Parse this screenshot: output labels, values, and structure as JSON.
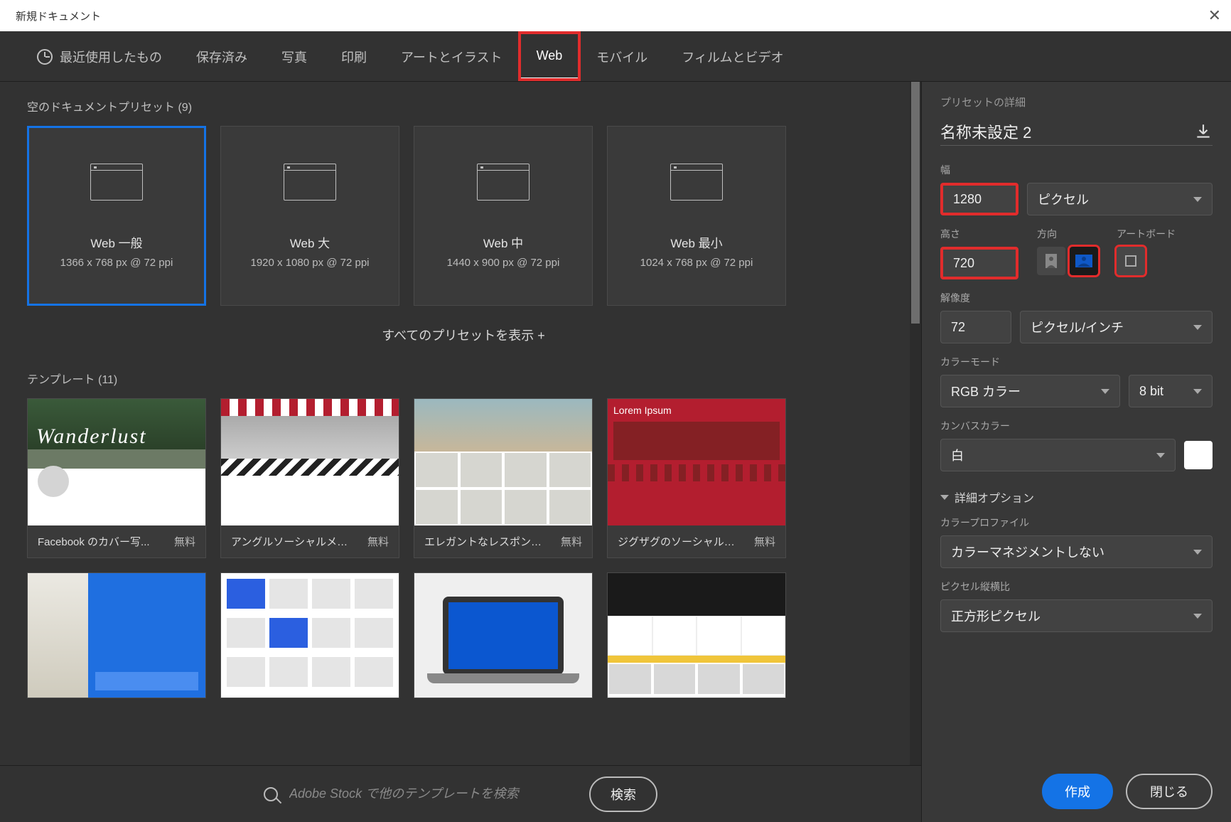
{
  "window": {
    "title": "新規ドキュメント"
  },
  "tabs": [
    {
      "label": "最近使用したもの"
    },
    {
      "label": "保存済み"
    },
    {
      "label": "写真"
    },
    {
      "label": "印刷"
    },
    {
      "label": "アートとイラスト"
    },
    {
      "label": "Web"
    },
    {
      "label": "モバイル"
    },
    {
      "label": "フィルムとビデオ"
    }
  ],
  "active_tab": "Web",
  "presets": {
    "heading_prefix": "空のドキュメントプリセット",
    "count_label": "(9)",
    "items": [
      {
        "name": "Web 一般",
        "dim": "1366 x 768 px @ 72 ppi"
      },
      {
        "name": "Web 大",
        "dim": "1920 x 1080 px @ 72 ppi"
      },
      {
        "name": "Web 中",
        "dim": "1440 x 900 px @ 72 ppi"
      },
      {
        "name": "Web 最小",
        "dim": "1024 x 768 px @ 72 ppi"
      }
    ],
    "show_all": "すべてのプリセットを表示 +"
  },
  "templates": {
    "heading_prefix": "テンプレート",
    "count_label": "(11)",
    "price_free": "無料",
    "row1": [
      {
        "name": "Facebook のカバー写..."
      },
      {
        "name": "アングルソーシャルメデ..."
      },
      {
        "name": "エレガントなレスポンシ..."
      },
      {
        "name": "ジグザグのソーシャルメ..."
      }
    ]
  },
  "search": {
    "placeholder": "Adobe Stock で他のテンプレートを検索",
    "button": "検索"
  },
  "details": {
    "header": "プリセットの詳細",
    "name_value": "名称未設定 2",
    "labels": {
      "width": "幅",
      "height": "高さ",
      "orientation": "方向",
      "artboard": "アートボード",
      "resolution": "解像度",
      "color_mode": "カラーモード",
      "canvas": "カンバスカラー",
      "advanced": "詳細オプション",
      "color_profile": "カラープロファイル",
      "pixel_ratio": "ピクセル縦横比"
    },
    "width_value": "1280",
    "height_value": "720",
    "unit_value": "ピクセル",
    "resolution_value": "72",
    "resolution_unit": "ピクセル/インチ",
    "color_mode_value": "RGB カラー",
    "bit_depth_value": "8 bit",
    "canvas_value": "白",
    "color_profile_value": "カラーマネジメントしない",
    "pixel_ratio_value": "正方形ピクセル"
  },
  "actions": {
    "create": "作成",
    "close": "閉じる"
  }
}
